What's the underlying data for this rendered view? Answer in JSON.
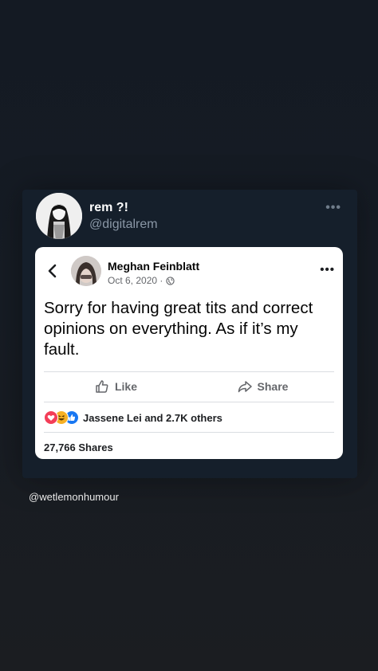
{
  "tweet": {
    "display_name": "rem ?!",
    "handle": "@digitalrem",
    "more_icon": "more-horizontal-icon"
  },
  "fb_post": {
    "author": "Meghan Feinblatt",
    "date": "Oct 6, 2020 · ",
    "privacy_icon": "globe-icon",
    "text": "Sorry for having great tits and correct opinions on everything. As if it’s my fault.",
    "like_label": "Like",
    "share_label": "Share",
    "reactions_text": "Jassene Lei and 2.7K others",
    "reaction_types": [
      "love",
      "haha",
      "like"
    ],
    "shares_text": "27,766 Shares"
  },
  "credit": "@wetlemonhumour",
  "colors": {
    "background": "#151b23",
    "card": "#151f2b",
    "fb_card": "#ffffff",
    "muted": "#65676b",
    "like_blue": "#1877f2",
    "love_red": "#f33e58",
    "haha_yellow": "#f7b125"
  }
}
